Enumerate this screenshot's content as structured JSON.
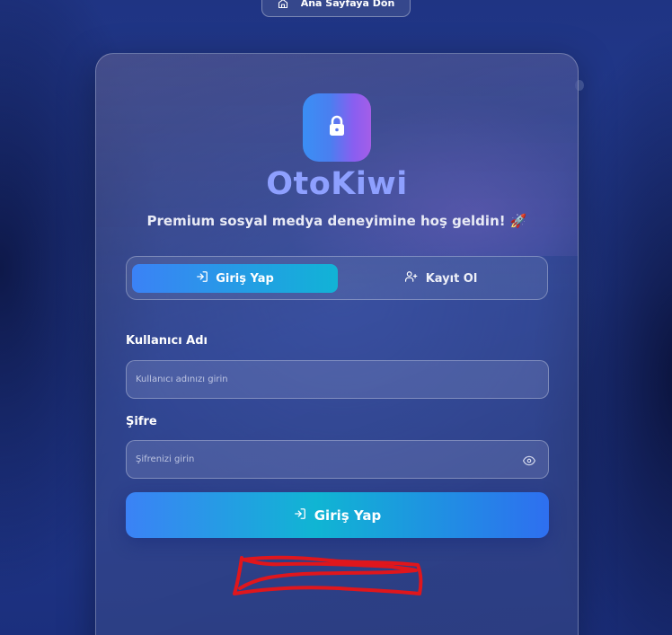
{
  "home_button": {
    "label": "Ana Sayfaya Dön",
    "icon": "home-icon"
  },
  "brand": {
    "name": "OtoKiwi",
    "logo_icon": "lock-icon"
  },
  "subtitle": "Premium sosyal medya deneyimine hoş geldin! 🚀",
  "tabs": [
    {
      "label": "Giriş Yap",
      "icon": "login-icon",
      "active": true
    },
    {
      "label": "Kayıt Ol",
      "icon": "user-plus-icon",
      "active": false
    }
  ],
  "form": {
    "username_label": "Kullanıcı Adı",
    "username_placeholder": "Kullanıcı adınızı girin",
    "password_label": "Şifre",
    "password_placeholder": "Şifrenizi girin",
    "password_toggle_icon": "eye-icon",
    "submit_label": "Giriş Yap",
    "submit_icon": "login-icon"
  },
  "annotation": {
    "type": "red-scribble",
    "color": "#e0161c"
  },
  "colors": {
    "accent_blue": "#3b82f6",
    "accent_cyan": "#10b5d3",
    "brand_text": "#8ea0ff"
  }
}
